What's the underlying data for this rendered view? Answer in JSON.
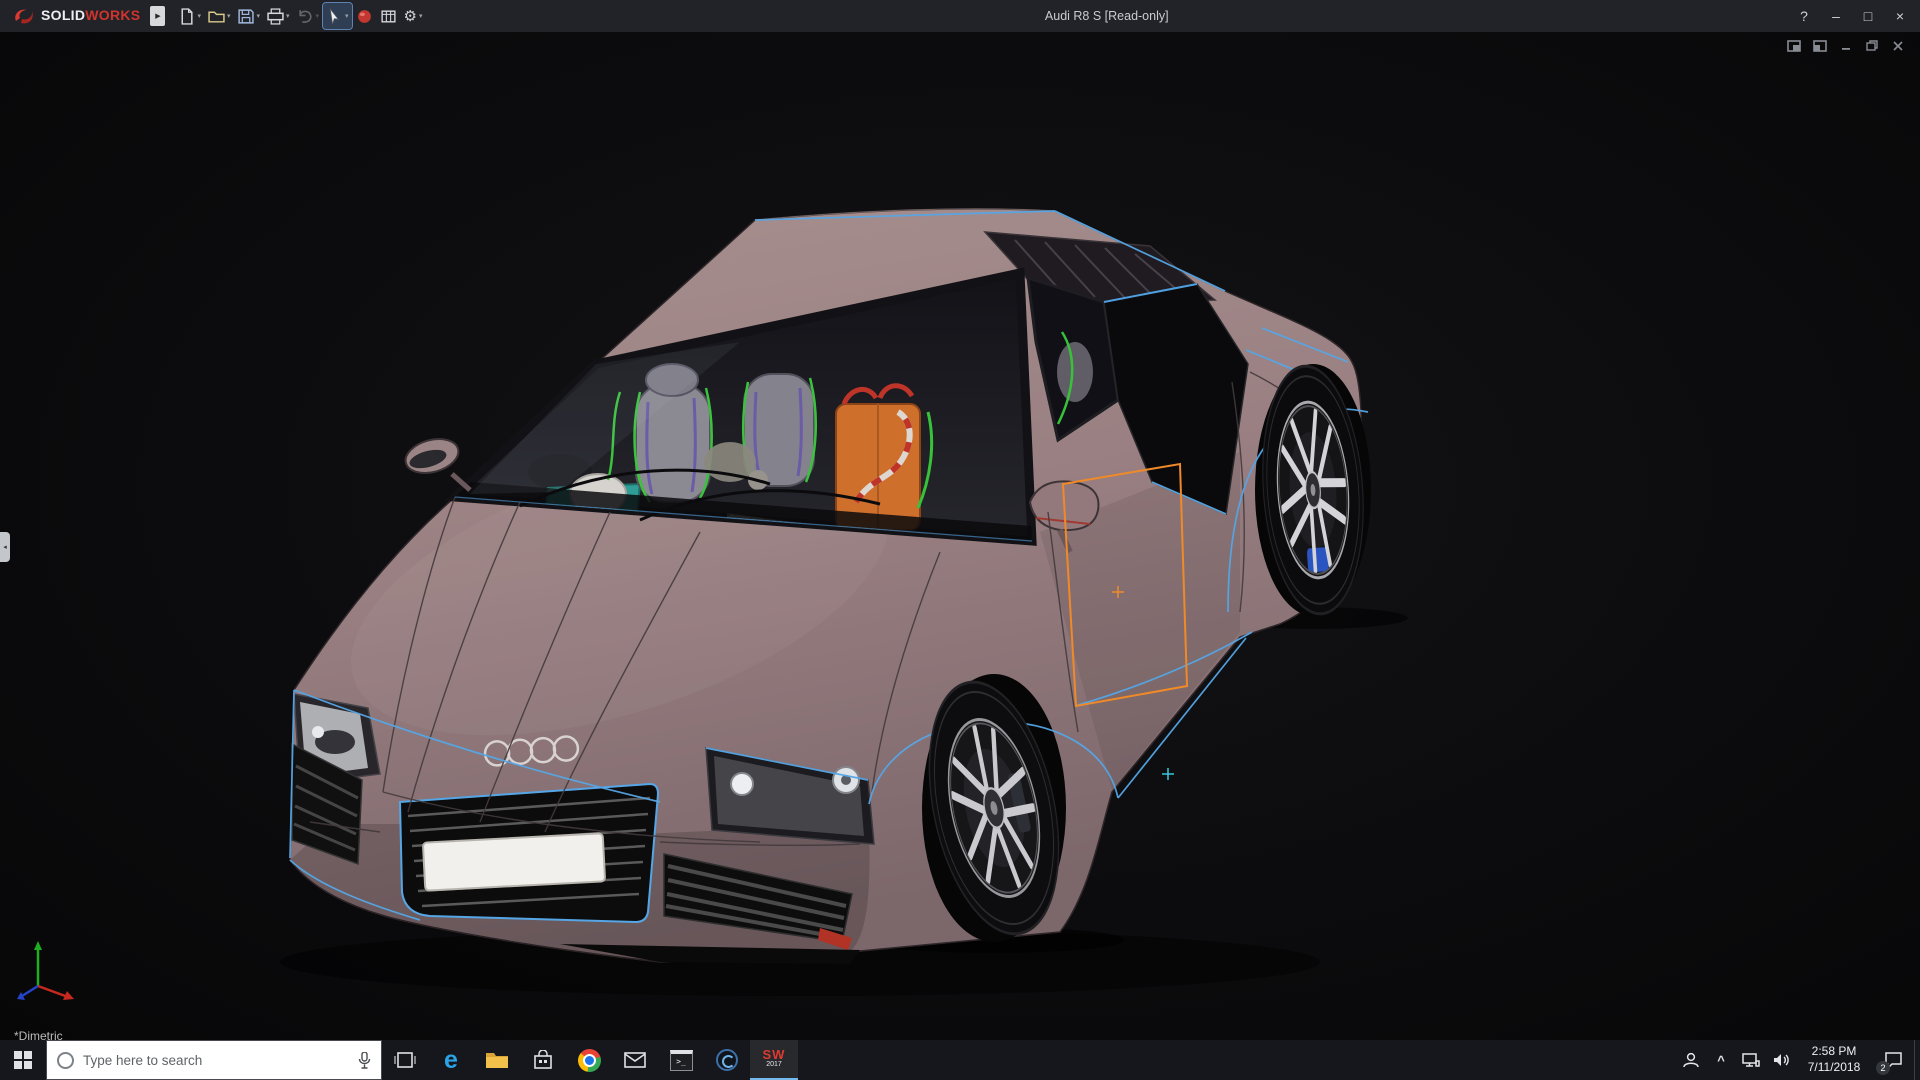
{
  "titlebar": {
    "brand": {
      "solid": "SOLID",
      "works": "WORKS"
    },
    "title": "Audi R8 S [Read-only]",
    "buttons": {
      "help": "?",
      "minimize": "–",
      "maximize": "□",
      "close": "×"
    }
  },
  "glyphs": {
    "dropdown_caret": "▾",
    "flyout_arrow": "▶",
    "left_panel_arrow": "◂",
    "gear": "⚙",
    "tray_caret": "^",
    "console": ">_",
    "edge_letter": "e"
  },
  "toolbar_icons": [
    "new-document",
    "open-document",
    "save",
    "print",
    "undo",
    "select-tool",
    "xpress-products",
    "design-binder",
    "options"
  ],
  "viewport": {
    "view_label": "*Dimetric",
    "model": "Audi R8 S 3D assembly, dimetric view",
    "accent_blue": "#55a6e6",
    "highlight_orange": "#f08a28",
    "body_color": "#9b8486"
  },
  "taskbar": {
    "search_placeholder": "Type here to search",
    "icons": [
      "start",
      "task-view",
      "edge",
      "file-explorer",
      "store",
      "chrome",
      "mail",
      "console",
      "media-app",
      "solidworks-2017"
    ],
    "solidworks_app": {
      "label": "SW",
      "year": "2017"
    },
    "tray_icons": [
      "people",
      "tray-expand",
      "network",
      "volume",
      "action-center"
    ],
    "clock": {
      "time": "2:58 PM",
      "date": "7/11/2018"
    },
    "notification_count": "2"
  }
}
